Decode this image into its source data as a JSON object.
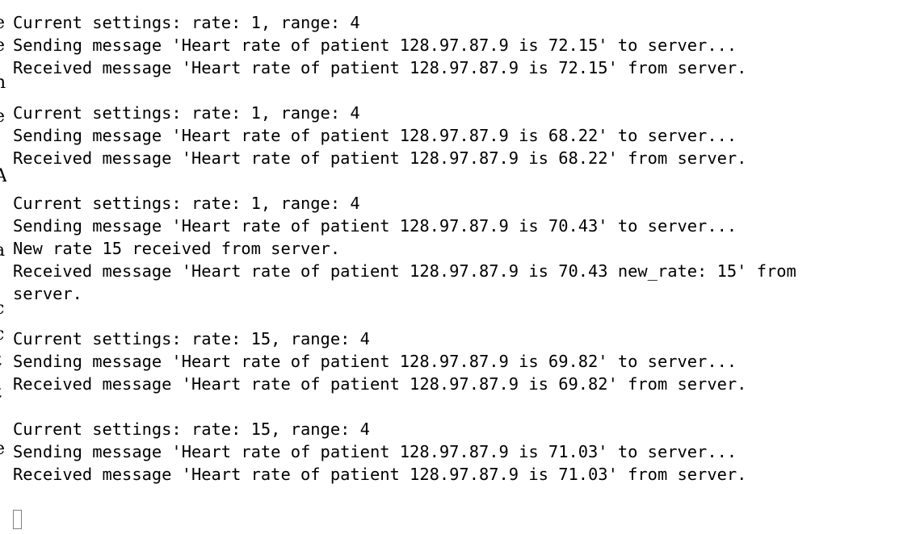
{
  "terminal": {
    "lines": [
      "Current settings: rate: 1, range: 4",
      "Sending message 'Heart rate of patient 128.97.87.9 is 72.15' to server...",
      "Received message 'Heart rate of patient 128.97.87.9 is 72.15' from server.",
      "",
      "Current settings: rate: 1, range: 4",
      "Sending message 'Heart rate of patient 128.97.87.9 is 68.22' to server...",
      "Received message 'Heart rate of patient 128.97.87.9 is 68.22' from server.",
      "",
      "Current settings: rate: 1, range: 4",
      "Sending message 'Heart rate of patient 128.97.87.9 is 70.43' to server...",
      "New rate 15 received from server.",
      "Received message 'Heart rate of patient 128.97.87.9 is 70.43 new_rate: 15' from",
      "server.",
      "",
      "Current settings: rate: 15, range: 4",
      "Sending message 'Heart rate of patient 128.97.87.9 is 69.82' to server...",
      "Received message 'Heart rate of patient 128.97.87.9 is 69.82' from server.",
      "",
      "Current settings: rate: 15, range: 4",
      "Sending message 'Heart rate of patient 128.97.87.9 is 71.03' to server...",
      "Received message 'Heart rate of patient 128.97.87.9 is 71.03' from server."
    ],
    "cursor_icon": "block-cursor-icon",
    "colors": {
      "background": "#ffffff",
      "text": "#000000",
      "cursor": "#808080"
    }
  }
}
